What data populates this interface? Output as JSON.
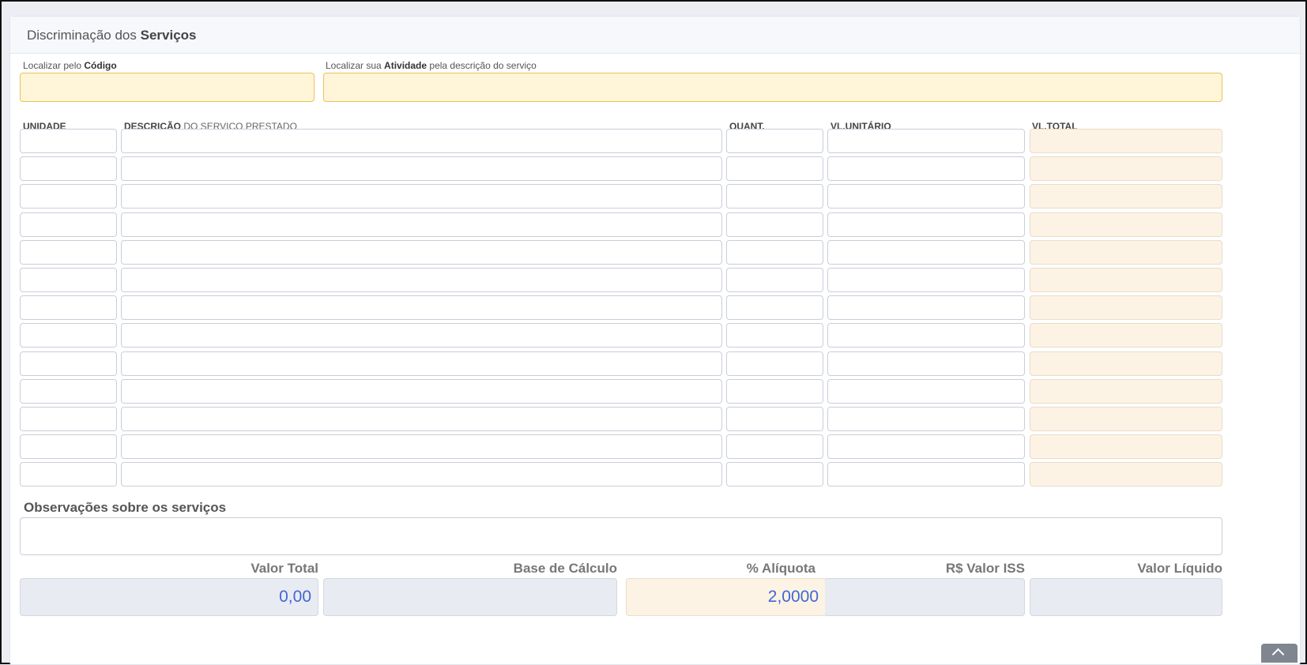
{
  "header": {
    "title_prefix": "Discriminação dos ",
    "title_bold": "Serviços"
  },
  "search": {
    "code_label_prefix": "Localizar pelo ",
    "code_label_bold": "Código",
    "code_value": "",
    "activity_label_prefix": "Localizar sua ",
    "activity_label_bold": "Atividade",
    "activity_label_suffix": " pela descrição do serviço",
    "activity_value": ""
  },
  "table": {
    "columns": {
      "unidade": "UNIDADE",
      "descricao_bold": "DESCRIÇÃO",
      "descricao_rest": " DO SERVIÇO PRESTADO",
      "quant": "QUANT.",
      "vl_unitario": "VL.UNITÁRIO",
      "vl_total": "VL.TOTAL"
    },
    "row_count": 13
  },
  "observacoes": {
    "title": "Observações sobre os serviços",
    "value": ""
  },
  "totals": {
    "valor_total_label": "Valor Total",
    "valor_total_value": "0,00",
    "base_calculo_label": "Base de Cálculo",
    "base_calculo_value": "",
    "aliquota_label": "% Alíquota",
    "aliquota_value": "2,0000",
    "valor_iss_label": "R$ Valor ISS",
    "valor_iss_value": "",
    "valor_liquido_label": "Valor Líquido",
    "valor_liquido_value": ""
  },
  "colors": {
    "accent": "#3f67d6",
    "search_bg": "#fff5d8",
    "readonly_bg": "#fdf3e4"
  },
  "icons": {
    "scroll_top": "chevron-up-icon"
  }
}
